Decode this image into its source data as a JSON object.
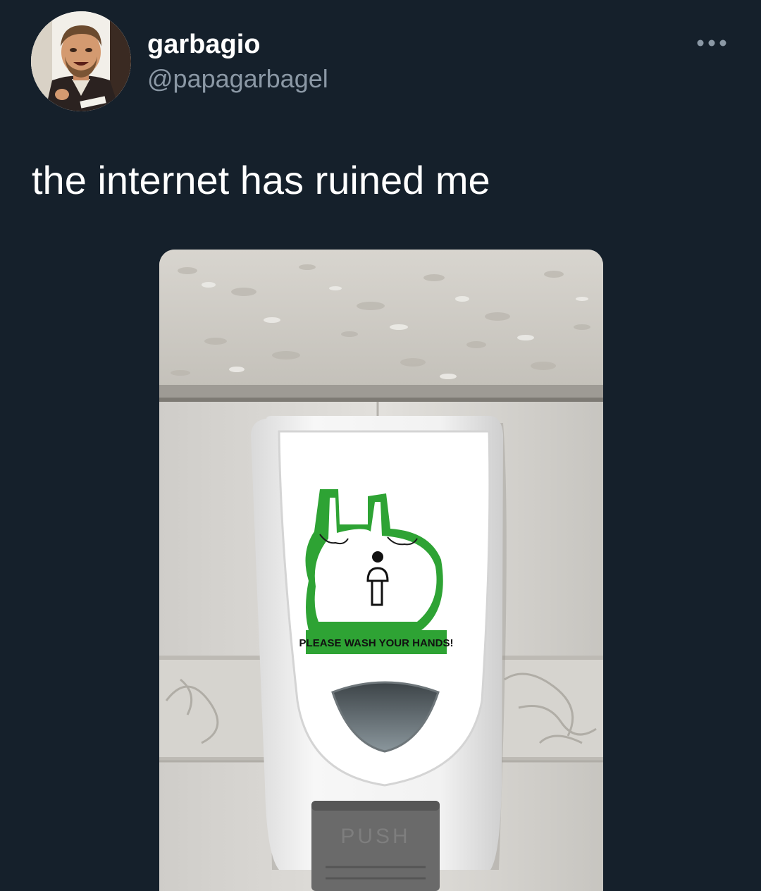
{
  "user": {
    "display_name": "garbagio",
    "handle": "@papagarbagel",
    "avatar_icon": "avatar-photo"
  },
  "more_icon": "more-horizontal-icon",
  "tweet": {
    "text": "the internet has ruined me"
  },
  "media": {
    "sticker_text": "PLEASE WASH YOUR HANDS!",
    "button_text": "PUSH"
  },
  "colors": {
    "background": "#15202b",
    "text_primary": "#ffffff",
    "text_secondary": "#8b98a5",
    "sticker_green": "#2ea334"
  }
}
